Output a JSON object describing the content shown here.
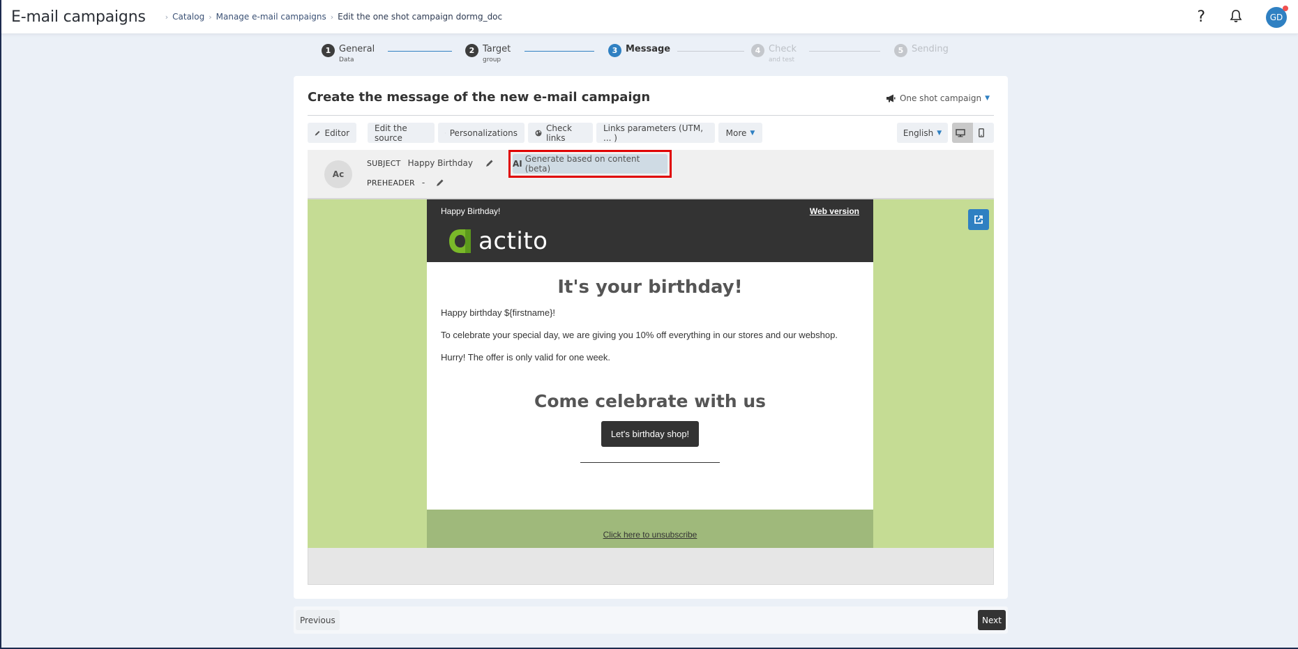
{
  "header": {
    "app_title": "E-mail campaigns",
    "breadcrumb": [
      "Catalog",
      "Manage e-mail campaigns",
      "Edit the one shot campaign dormg_doc"
    ],
    "icons": {
      "help": "question-icon",
      "notifications": "bell-icon"
    },
    "user_initials": "GD",
    "notification_dot_color": "#f0504f"
  },
  "stepper": {
    "steps": [
      {
        "number": "1",
        "label": "General",
        "sub": "Data",
        "state": "done"
      },
      {
        "number": "2",
        "label": "Target",
        "sub": "group",
        "state": "done"
      },
      {
        "number": "3",
        "label": "Message",
        "sub": "",
        "state": "active"
      },
      {
        "number": "4",
        "label": "Check",
        "sub": "and test",
        "state": "disabled"
      },
      {
        "number": "5",
        "label": "Sending",
        "sub": "",
        "state": "disabled"
      }
    ]
  },
  "card": {
    "title": "Create the message of the new e-mail campaign",
    "campaign_type": "One shot campaign"
  },
  "toolbar": {
    "editor": "Editor",
    "edit_source": "Edit the source",
    "personalizations": "Personalizations",
    "check_links": "Check links",
    "links_parameters": "Links parameters (UTM, ... )",
    "more": "More",
    "language": "English",
    "view_modes": [
      "desktop",
      "mobile"
    ],
    "active_view": "desktop"
  },
  "subject_bar": {
    "sender_initials": "Ac",
    "subject_label": "SUBJECT",
    "subject_value": "Happy Birthday",
    "preheader_label": "PREHEADER",
    "preheader_value": "-",
    "ai_prefix": "AI",
    "ai_button": "Generate based on content (beta)"
  },
  "email": {
    "header_title": "Happy Birthday!",
    "web_version": "Web version",
    "logo_text": "actito",
    "heading": "It's your birthday!",
    "paragraphs": [
      "Happy birthday ${firstname}!",
      "To celebrate your special day, we are giving you 10% off everything in our stores and our webshop.",
      "Hurry! The offer is only valid for one week."
    ],
    "heading2": "Come celebrate with us",
    "cta": "Let's birthday shop!",
    "unsubscribe": "Click here to unsubscribe",
    "colors": {
      "background": "#c5dc94",
      "header": "#333333",
      "footer": "#9fb97b",
      "logo_green": "#7ab929"
    }
  },
  "footer_nav": {
    "previous": "Previous",
    "next": "Next"
  },
  "colors": {
    "accent": "#2f80c2",
    "highlight_border": "#e00000"
  }
}
